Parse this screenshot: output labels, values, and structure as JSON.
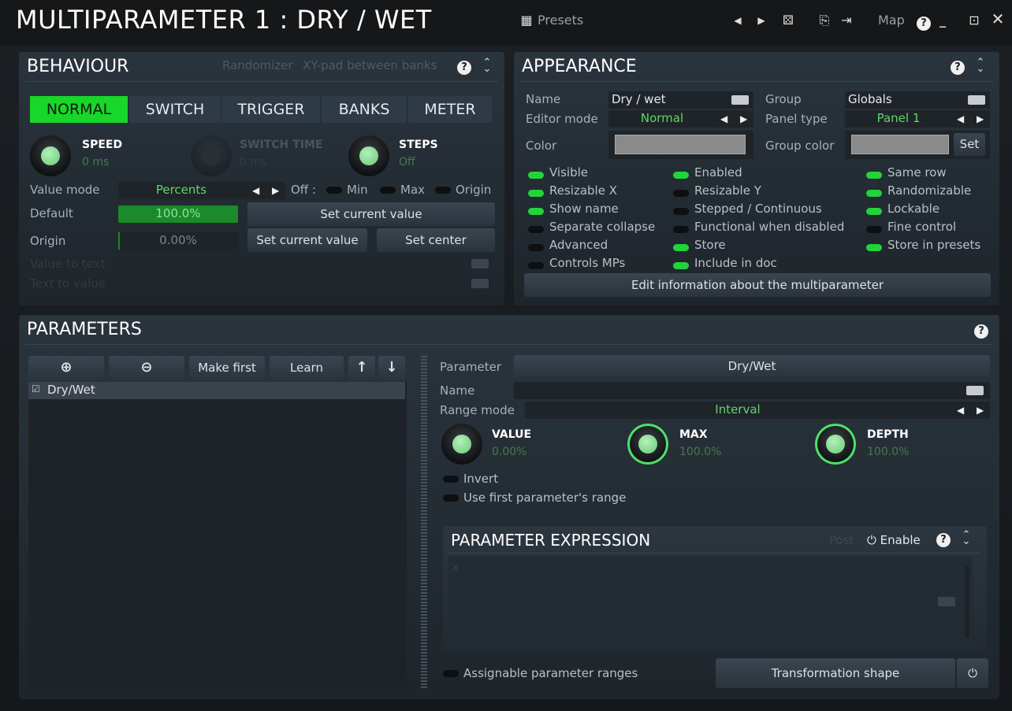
{
  "window": {
    "title": "MULTIPARAMETER 1 : DRY / WET",
    "presets_label": "Presets",
    "map_label": "Map",
    "help": "?"
  },
  "behaviour": {
    "title": "BEHAVIOUR",
    "randomizer": "Randomizer",
    "xy_pad": "XY-pad between banks",
    "tabs": [
      "NORMAL",
      "SWITCH",
      "TRIGGER",
      "BANKS",
      "METER"
    ],
    "active_tab": "NORMAL",
    "speed": {
      "name": "SPEED",
      "value": "0 ms"
    },
    "switch_time": {
      "name": "SWITCH TIME",
      "value": "0 ms"
    },
    "steps": {
      "name": "STEPS",
      "value": "Off"
    },
    "value_mode_label": "Value mode",
    "value_mode": "Percents",
    "off_label": "Off :",
    "min_label": "Min",
    "max_label": "Max",
    "origin_label": "Origin",
    "default_label": "Default",
    "default_value": "100.0%",
    "default_fill": 1.0,
    "set_current_value": "Set current value",
    "origin_label2": "Origin",
    "origin_value": "0.00%",
    "set_center": "Set center",
    "value_to_text": "Value to text",
    "text_to_value": "Text to value"
  },
  "appearance": {
    "title": "APPEARANCE",
    "name_label": "Name",
    "name_value": "Dry / wet",
    "group_label": "Group",
    "group_value": "Globals",
    "editor_mode_label": "Editor mode",
    "editor_mode": "Normal",
    "panel_type_label": "Panel type",
    "panel_type": "Panel 1",
    "color_label": "Color",
    "group_color_label": "Group color",
    "set": "Set",
    "color_value": "#8a8a8a",
    "toggles": [
      {
        "label": "Visible",
        "on": true
      },
      {
        "label": "Enabled",
        "on": true
      },
      {
        "label": "Same row",
        "on": true
      },
      {
        "label": "Resizable X",
        "on": true
      },
      {
        "label": "Resizable Y",
        "on": false
      },
      {
        "label": "Randomizable",
        "on": true
      },
      {
        "label": "Show name",
        "on": true
      },
      {
        "label": "Stepped / Continuous",
        "on": false
      },
      {
        "label": "Lockable",
        "on": true
      },
      {
        "label": "Separate collapse",
        "on": false
      },
      {
        "label": "Functional when disabled",
        "on": false
      },
      {
        "label": "Fine control",
        "on": false
      },
      {
        "label": "Advanced",
        "on": false
      },
      {
        "label": "Store",
        "on": true
      },
      {
        "label": "Store in presets",
        "on": true
      },
      {
        "label": "Controls MPs",
        "on": false
      },
      {
        "label": "Include in doc",
        "on": true
      }
    ],
    "edit_info": "Edit information about the multiparameter"
  },
  "parameters": {
    "title": "PARAMETERS",
    "make_first": "Make first",
    "learn": "Learn",
    "list": [
      "Dry/Wet"
    ],
    "parameter_label": "Parameter",
    "parameter_value": "Dry/Wet",
    "name_label": "Name",
    "range_mode_label": "Range mode",
    "range_mode": "Interval",
    "value": {
      "name": "VALUE",
      "value": "0.00%",
      "level": 0.0
    },
    "max": {
      "name": "MAX",
      "value": "100.0%",
      "level": 1.0
    },
    "depth": {
      "name": "DEPTH",
      "value": "100.0%",
      "level": 1.0
    },
    "invert": "Invert",
    "use_first": "Use first parameter's range",
    "assignable": "Assignable parameter ranges",
    "transformation_shape": "Transformation shape"
  },
  "expression": {
    "title": "PARAMETER EXPRESSION",
    "post": "Post",
    "enable": "Enable",
    "placeholder": "x"
  },
  "colors": {
    "accent": "#22d43a",
    "panel": "#2a343d",
    "background": "#15181b"
  }
}
